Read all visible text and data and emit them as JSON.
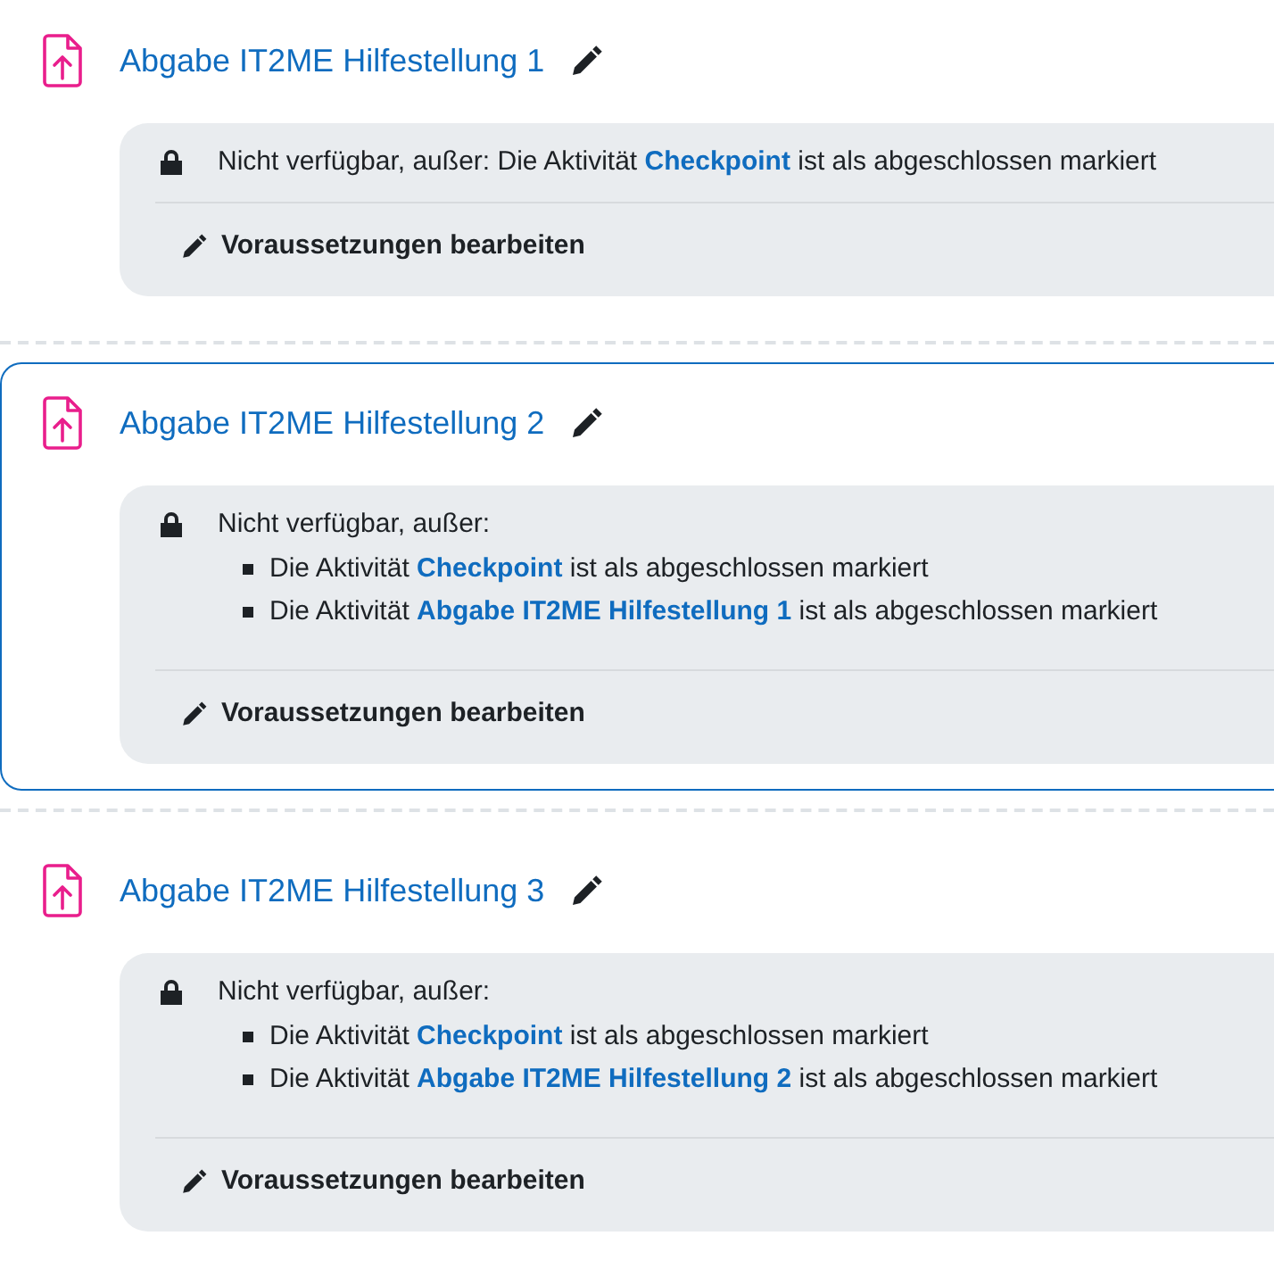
{
  "activities": [
    {
      "title": "Abgabe IT2ME Hilfestellung 1",
      "selected": false,
      "restriction": {
        "intro": "Nicht verfügbar, außer:",
        "conditions": [
          {
            "before": "Die Aktivität",
            "link": "Checkpoint",
            "after": "ist als abgeschlossen markiert"
          }
        ]
      },
      "edit_label": "Voraussetzungen bearbeiten"
    },
    {
      "title": "Abgabe IT2ME Hilfestellung 2",
      "selected": true,
      "restriction": {
        "intro": "Nicht verfügbar, außer:",
        "conditions": [
          {
            "before": "Die Aktivität",
            "link": "Checkpoint",
            "after": "ist als abgeschlossen markiert"
          },
          {
            "before": "Die Aktivität",
            "link": "Abgabe IT2ME Hilfestellung 1",
            "after": "ist als abgeschlossen markiert"
          }
        ]
      },
      "edit_label": "Voraussetzungen bearbeiten"
    },
    {
      "title": "Abgabe IT2ME Hilfestellung 3",
      "selected": false,
      "restriction": {
        "intro": "Nicht verfügbar, außer:",
        "conditions": [
          {
            "before": "Die Aktivität",
            "link": "Checkpoint",
            "after": "ist als abgeschlossen markiert"
          },
          {
            "before": "Die Aktivität",
            "link": "Abgabe IT2ME Hilfestellung 2",
            "after": "ist als abgeschlossen markiert"
          }
        ]
      },
      "edit_label": "Voraussetzungen bearbeiten"
    }
  ]
}
